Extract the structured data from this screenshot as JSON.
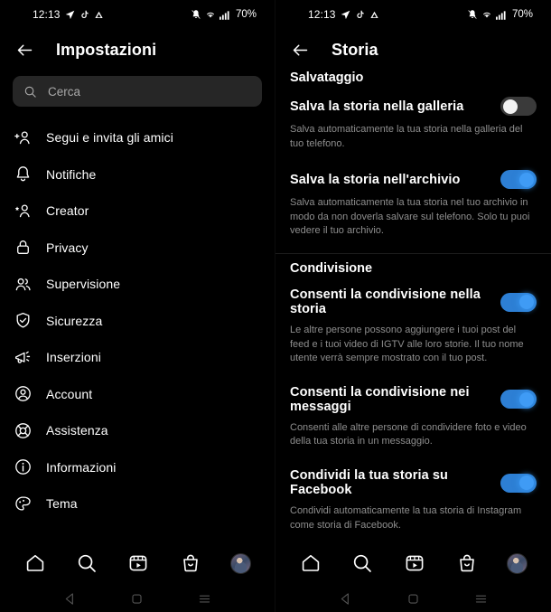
{
  "statusbar": {
    "time": "12:13",
    "battery": "70%",
    "icons": [
      "location-arrow-icon",
      "tiktok-icon",
      "triangle-icon",
      "bell-muted-icon",
      "wifi-icon",
      "signal-bars-icon"
    ]
  },
  "left": {
    "header": {
      "title": "Impostazioni",
      "back": "back-arrow-icon"
    },
    "search": {
      "placeholder": "Cerca",
      "icon": "search-icon"
    },
    "menu": [
      {
        "label": "Segui e invita gli amici",
        "icon": "person-add-icon"
      },
      {
        "label": "Notifiche",
        "icon": "bell-icon"
      },
      {
        "label": "Creator",
        "icon": "person-star-icon"
      },
      {
        "label": "Privacy",
        "icon": "lock-icon"
      },
      {
        "label": "Supervisione",
        "icon": "people-icon"
      },
      {
        "label": "Sicurezza",
        "icon": "shield-check-icon"
      },
      {
        "label": "Inserzioni",
        "icon": "megaphone-icon"
      },
      {
        "label": "Account",
        "icon": "account-circle-icon"
      },
      {
        "label": "Assistenza",
        "icon": "lifebuoy-icon"
      },
      {
        "label": "Informazioni",
        "icon": "info-circle-icon"
      },
      {
        "label": "Tema",
        "icon": "palette-icon"
      }
    ]
  },
  "right": {
    "header": {
      "title": "Storia",
      "back": "back-arrow-icon"
    },
    "sections": [
      {
        "title": "Salvataggio",
        "rows": [
          {
            "label": "Salva la storia nella galleria",
            "desc": "Salva automaticamente la tua storia nella galleria del tuo telefono.",
            "toggle": "off"
          },
          {
            "label": "Salva la storia nell'archivio",
            "desc": "Salva automaticamente la tua storia nel tuo archivio in modo da non doverla salvare sul telefono. Solo tu puoi vedere il tuo archivio.",
            "toggle": "on"
          }
        ]
      },
      {
        "title": "Condivisione",
        "rows": [
          {
            "label": "Consenti la condivisione nella storia",
            "desc": "Le altre persone possono aggiungere i tuoi post del feed e i tuoi video di IGTV alle loro storie. Il tuo nome utente verrà sempre mostrato con il tuo post.",
            "toggle": "on"
          },
          {
            "label": "Consenti la condivisione nei messaggi",
            "desc": "Consenti alle altre persone di condividere foto e video della tua storia in un messaggio.",
            "toggle": "on"
          },
          {
            "label": "Condividi la tua storia su Facebook",
            "desc": "Condividi automaticamente la tua storia di Instagram come storia di Facebook.",
            "toggle": "on"
          }
        ]
      }
    ]
  },
  "botnav": [
    "home-icon",
    "search-icon",
    "reels-icon",
    "shop-icon",
    "profile-avatar"
  ],
  "sysnav": [
    "back-triangle-icon",
    "home-square-icon",
    "menu-lines-icon"
  ],
  "colors": {
    "accent": "#3897f0",
    "toggle_on_track": "#2d7fd4",
    "toggle_off_track": "#3a3a3a",
    "muted_text": "#8e8e8e"
  }
}
